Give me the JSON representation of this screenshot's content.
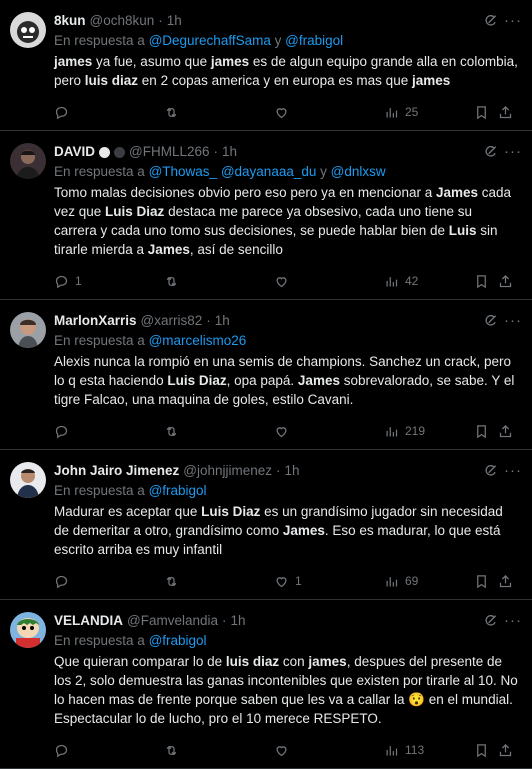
{
  "reply_prefix": "En respuesta a",
  "tweets": [
    {
      "name": "8kun",
      "handle": "@och8kun",
      "time": "1h",
      "mentions": [
        "@DegurechaffSama",
        "y",
        "@frabigol"
      ],
      "segments": [
        {
          "t": "james",
          "b": true
        },
        {
          "t": " ya fue, asumo que ",
          "b": false
        },
        {
          "t": "james",
          "b": true
        },
        {
          "t": " es de algun equipo grande alla en colombia, pero ",
          "b": false
        },
        {
          "t": "luis  diaz",
          "b": true
        },
        {
          "t": " en 2 copas america y en europa es mas que ",
          "b": false
        },
        {
          "t": "james",
          "b": true
        }
      ],
      "replies": "",
      "retweets": "",
      "likes": "",
      "views": "25"
    },
    {
      "name": "DAVID",
      "handle": "@FHMLL266",
      "time": "1h",
      "mentions": [
        "@Thowas_",
        "@dayanaaa_du",
        "y",
        "@dnlxsw"
      ],
      "segments": [
        {
          "t": "Tomo malas decisiones obvio pero eso pero ya en mencionar a ",
          "b": false
        },
        {
          "t": "James",
          "b": true
        },
        {
          "t": " cada vez que ",
          "b": false
        },
        {
          "t": "Luis Diaz",
          "b": true
        },
        {
          "t": " destaca me parece ya obsesivo, cada uno tiene su carrera y cada uno tomo sus decisiones, se puede hablar bien de ",
          "b": false
        },
        {
          "t": "Luis",
          "b": true
        },
        {
          "t": " sin tirarle mierda a ",
          "b": false
        },
        {
          "t": "James",
          "b": true
        },
        {
          "t": ", así de sencillo",
          "b": false
        }
      ],
      "replies": "1",
      "retweets": "",
      "likes": "",
      "views": "42"
    },
    {
      "name": "MarlonXarris",
      "handle": "@xarris82",
      "time": "1h",
      "mentions": [
        "@marcelismo26"
      ],
      "segments": [
        {
          "t": "Alexis nunca la rompió en una semis de champions. Sanchez un crack, pero lo q esta haciendo ",
          "b": false
        },
        {
          "t": "Luis Diaz",
          "b": true
        },
        {
          "t": ", opa papá. ",
          "b": false
        },
        {
          "t": "James",
          "b": true
        },
        {
          "t": " sobrevalorado, se sabe. Y el tigre Falcao, una maquina de goles, estilo Cavani.",
          "b": false
        }
      ],
      "replies": "",
      "retweets": "",
      "likes": "",
      "views": "219"
    },
    {
      "name": "John Jairo Jimenez",
      "handle": "@johnjjimenez",
      "time": "1h",
      "mentions": [
        "@frabigol"
      ],
      "segments": [
        {
          "t": "Madurar es aceptar que ",
          "b": false
        },
        {
          "t": "Luis Diaz",
          "b": true
        },
        {
          "t": " es un grandísimo jugador sin necesidad de demeritar a otro, grandísimo como ",
          "b": false
        },
        {
          "t": "James",
          "b": true
        },
        {
          "t": ". Eso es madurar, lo que está escrito arriba es muy infantil",
          "b": false
        }
      ],
      "replies": "",
      "retweets": "",
      "likes": "1",
      "views": "69"
    },
    {
      "name": "VELANDIA",
      "handle": "@Famvelandia",
      "time": "1h",
      "mentions": [
        "@frabigol"
      ],
      "segments": [
        {
          "t": "Que quieran comparar lo de ",
          "b": false
        },
        {
          "t": "luis diaz",
          "b": true
        },
        {
          "t": " con ",
          "b": false
        },
        {
          "t": "james",
          "b": true
        },
        {
          "t": ", despues del presente de los 2, solo demuestra las ganas incontenibles que existen por tirarle al 10. No lo hacen mas de frente porque saben que les va a callar la 😯 en el mundial. Espectacular lo de lucho, pro el 10 merece RESPETO.",
          "b": false
        }
      ],
      "replies": "",
      "retweets": "",
      "likes": "",
      "views": "113"
    }
  ],
  "icons": {
    "reply": "reply-icon",
    "retweet": "retweet-icon",
    "like": "heart-icon",
    "views": "views-icon",
    "bookmark": "bookmark-icon",
    "share": "share-icon",
    "grok": "grok-icon",
    "more": "more-icon"
  },
  "colors": {
    "background": "#000000",
    "text": "#e7e9ea",
    "muted": "#71767b",
    "link": "#1d9bf0",
    "divider": "#2f3336"
  }
}
